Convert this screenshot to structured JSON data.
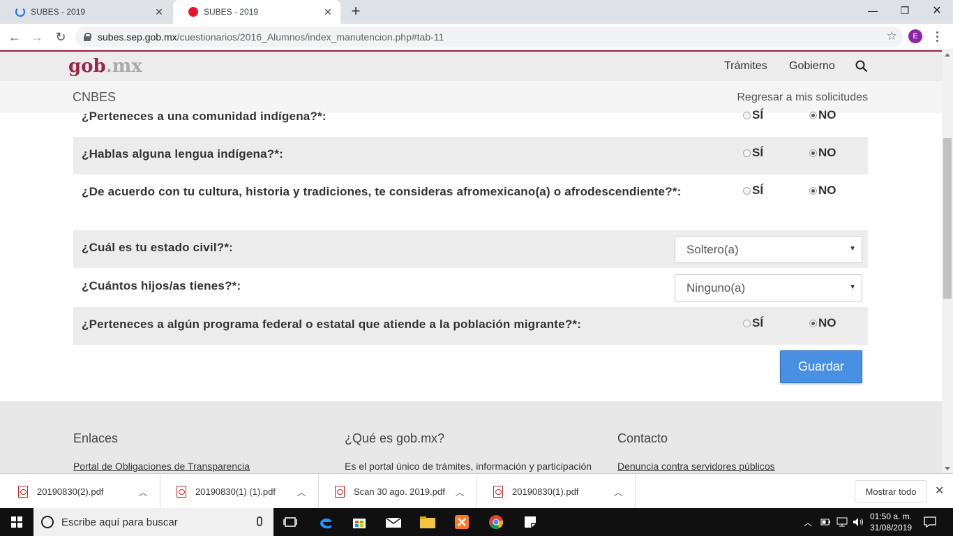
{
  "browser": {
    "tabs": [
      {
        "title": "SUBES - 2019",
        "state": "loading"
      },
      {
        "title": "SUBES - 2019",
        "state": "active"
      }
    ],
    "url_host": "subes.sep.gob.mx",
    "url_path": "/cuestionarios/2016_Alumnos/index_manutencion.php#tab-11",
    "profile_initial": "E"
  },
  "header": {
    "logo_gob": "gob",
    "logo_mx": ".mx",
    "nav": [
      "Trámites",
      "Gobierno"
    ],
    "brand": "CNBES",
    "back_link": "Regresar a mis solicitudes"
  },
  "form": {
    "yes_label": "SÍ",
    "no_label": "NO",
    "questions": [
      {
        "text": "¿Perteneces a una comunidad indígena?*:",
        "answer": "NO"
      },
      {
        "text": "¿Hablas alguna lengua indígena?*:",
        "answer": "NO"
      },
      {
        "text": "¿De acuerdo con tu cultura, historia y tradiciones, te consideras afromexicano(a) o afrodescendiente?*:",
        "answer": "NO"
      },
      {
        "text": "¿Cuál es tu estado civil?*:",
        "select_value": "Soltero(a)"
      },
      {
        "text": "¿Cuántos hijos/as tienes?*:",
        "select_value": "Ninguno(a)"
      },
      {
        "text": "¿Perteneces a algún programa federal o estatal que atiende a la población migrante?*:",
        "answer": "NO"
      }
    ],
    "save_label": "Guardar"
  },
  "footer": {
    "col1_title": "Enlaces",
    "col1_link": "Portal de Obligaciones de Transparencia",
    "col2_title": "¿Qué es gob.mx?",
    "col2_text": "Es el portal único de trámites, información y participación",
    "col3_title": "Contacto",
    "col3_link": "Denuncia contra servidores públicos"
  },
  "downloads": {
    "items": [
      "20190830(2).pdf",
      "20190830(1) (1).pdf",
      "Scan 30 ago. 2019.pdf",
      "20190830(1).pdf"
    ],
    "show_all": "Mostrar todo"
  },
  "taskbar": {
    "search_placeholder": "Escribe aquí para buscar",
    "time": "01:50 a. m.",
    "date": "31/08/2019"
  },
  "colors": {
    "gob_red": "#9d2449",
    "button_blue": "#4a90e2"
  }
}
